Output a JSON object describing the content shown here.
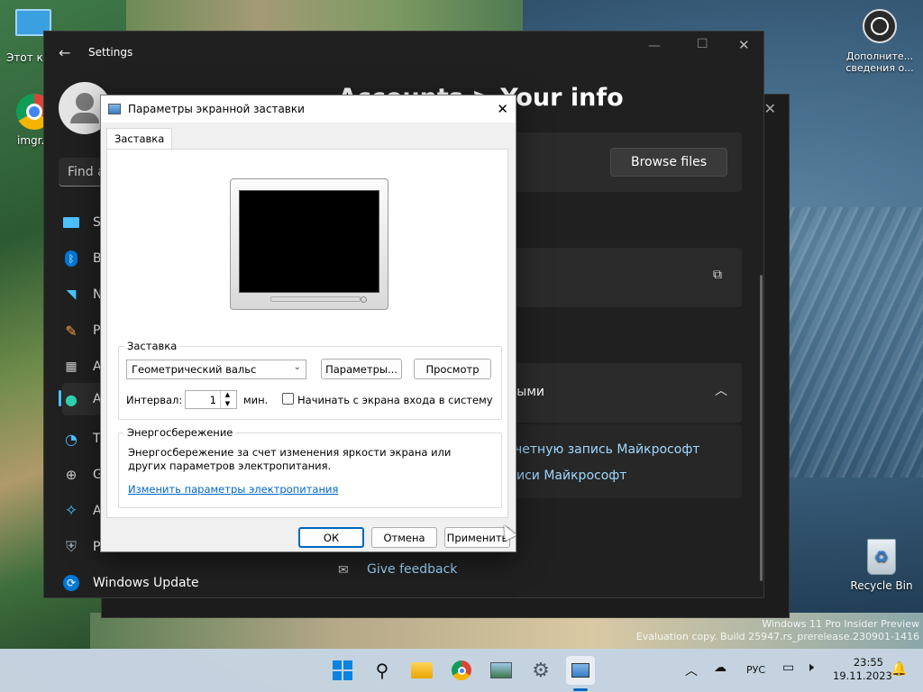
{
  "desktop": {
    "icons": [
      {
        "label": "Этот компь..."
      },
      {
        "label": "imgr..."
      },
      {
        "label": "Дополните... сведения о..."
      },
      {
        "label": "Recycle Bin"
      }
    ],
    "watermark": {
      "line1": "Windows 11 Pro Insider Preview",
      "line2": "Evaluation copy. Build 25947.rs_prerelease.230901-1416"
    }
  },
  "settings": {
    "title": "Settings",
    "search_placeholder": "Find a",
    "header": "Accounts  >  Your info",
    "browse_button": "Browse files",
    "nav": [
      {
        "label": "S",
        "icon": "system-icon"
      },
      {
        "label": "B",
        "icon": "bluetooth-icon"
      },
      {
        "label": "N",
        "icon": "network-icon"
      },
      {
        "label": "P",
        "icon": "personalization-icon"
      },
      {
        "label": "A",
        "icon": "apps-icon"
      },
      {
        "label": "A",
        "icon": "accounts-icon"
      },
      {
        "label": "T",
        "icon": "time-icon"
      },
      {
        "label": "G",
        "icon": "gaming-icon"
      },
      {
        "label": "A",
        "icon": "accessibility-icon"
      },
      {
        "label": "P",
        "icon": "privacy-icon"
      },
      {
        "label": "Windows Update",
        "icon": "update-icon"
      }
    ],
    "account_section": "нными",
    "link1": "четную запись Майкрософт",
    "link2": "иси Майкрософт",
    "feedback": "Give feedback"
  },
  "dialog": {
    "title": "Параметры экранной заставки",
    "tab": "Заставка",
    "screensaver_group": "Заставка",
    "screensaver_selected": "Геометрический вальс",
    "params_button": "Параметры...",
    "preview_button": "Просмотр",
    "interval_label": "Интервал:",
    "interval_value": "1",
    "interval_unit": "мин.",
    "logon_checkbox": "Начинать с экрана входа в систему",
    "power_group": "Энергосбережение",
    "power_text": "Энергосбережение за счет изменения яркости экрана или других параметров электропитания.",
    "power_link": "Изменить параметры электропитания",
    "ok": "ОК",
    "cancel": "Отмена",
    "apply": "Применить"
  },
  "taskbar": {
    "language": "РУС",
    "time": "23:55",
    "date": "19.11.2023"
  },
  "colors": {
    "accent": "#0067c0",
    "link": "#0066cc",
    "settings_bg": "#202020"
  }
}
